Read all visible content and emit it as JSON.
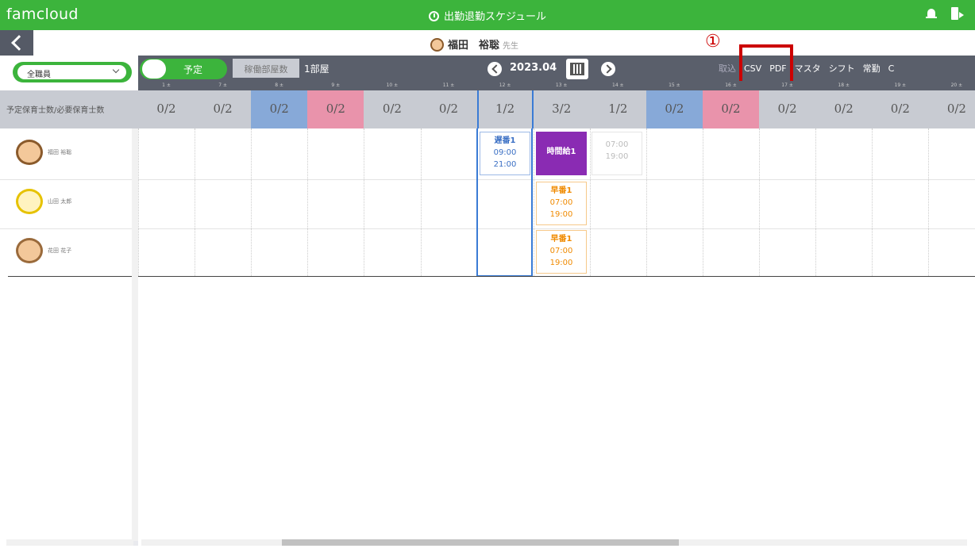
{
  "app": {
    "brand": "famcloud",
    "title": "出勤退勤スケジュール"
  },
  "user": {
    "name": "福田　裕聡",
    "suffix": "先生"
  },
  "annotation": {
    "number": "①"
  },
  "toolbar": {
    "staff_filter": "全職員",
    "toggle_label": "予定",
    "rooms_button": "稼働部屋数",
    "room_label": "1部屋",
    "month": "2023.04",
    "buttons": [
      "取込",
      "CSV",
      "PDF",
      "マスタ",
      "シフト",
      "常勤",
      "C"
    ]
  },
  "grid": {
    "row_label": "予定保育士数/必要保育士数",
    "days": [
      "1 ±",
      "7 ±",
      "8 ±",
      "9 ±",
      "10 ±",
      "11 ±",
      "12 ±",
      "13 ±",
      "14 ±",
      "15 ±",
      "16 ±",
      "17 ±",
      "18 ±",
      "19 ±",
      "20 ±"
    ],
    "counts": [
      "0/2",
      "0/2",
      "0/2",
      "0/2",
      "0/2",
      "0/2",
      "1/2",
      "3/2",
      "1/2",
      "0/2",
      "0/2",
      "0/2",
      "0/2",
      "0/2",
      "0/2"
    ],
    "col_colors": [
      "",
      "",
      "blue",
      "pink",
      "",
      "",
      "today",
      "",
      "",
      "blue",
      "pink",
      "",
      "",
      "",
      ""
    ]
  },
  "staff": [
    {
      "name": "福田 裕聡"
    },
    {
      "name": "山田 太郎"
    },
    {
      "name": "花田 花子"
    }
  ],
  "shifts": {
    "s1": {
      "title": "遅番1",
      "start": "09:00",
      "end": "21:00"
    },
    "s2": {
      "title": "時間給1"
    },
    "s3": {
      "start": "07:00",
      "end": "19:00"
    },
    "s4": {
      "title": "早番1",
      "start": "07:00",
      "end": "19:00"
    },
    "s5": {
      "title": "早番1",
      "start": "07:00",
      "end": "19:00"
    }
  },
  "colors": {
    "green": "#3cb43c",
    "toolbar": "#5a5f6b",
    "blue": "#87a9d8",
    "pink": "#e993ab",
    "purple": "#8a2bb3",
    "orange": "#f08a00",
    "annotation": "#cc0000"
  }
}
